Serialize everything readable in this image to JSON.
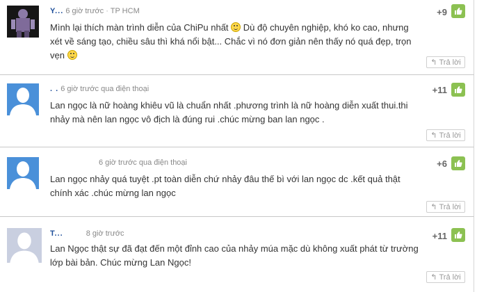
{
  "comments": [
    {
      "name": "Y...",
      "time": "6 giờ trước",
      "location": "TP HCM",
      "text_part1": "Mình lại thích màn trình diễn của ChiPu nhất",
      "text_part2": "Dù độ chuyên nghiệp, khó ko cao, nhưng xét về sáng tạo, chiều sâu thì khá nổi bật... Chắc vì nó đơn giản nên thấy nó quá đẹp, trọn vẹn",
      "score": "+9",
      "reply": "Trả lời"
    },
    {
      "name": ". .",
      "time": "6 giờ trước",
      "location": "qua điện thoại",
      "text": "Lan ngọc là nữ hoàng khiêu vũ là chuẩn nhất .phương trình là nữ hoàng diễn xuất thui.thi nhảy mà nên lan ngọc vô địch là đúng rui .chúc mừng ban lan ngọc .",
      "score": "+11",
      "reply": "Trả lời"
    },
    {
      "name": "",
      "time": "6 giờ trước",
      "location": "qua điện thoại",
      "text": "Lan ngọc nhảy quá tuyệt .pt toàn diễn chứ nhảy đâu thế bì với lan ngọc dc .kết quả thật chính xác .chúc mừng lan ngọc",
      "score": "+6",
      "reply": "Trả lời"
    },
    {
      "name": "T...",
      "time": "8 giờ trước",
      "location": "",
      "text": "Lan Ngọc thật sự đã đạt đến một đỉnh cao của nhảy múa mặc dù không xuất phát từ trường lớp bài bản. Chúc mừng Lan Ngọc!",
      "score": "+11",
      "reply": "Trả lời"
    }
  ],
  "colors": {
    "like": "#8cc152",
    "name": "#1f4f9a",
    "avatar_bg": "#4a90d9",
    "avatar_bg_light": "#c9cfe0"
  },
  "icons": {
    "like": "thumbs-up-icon",
    "reply": "reply-arrow-icon",
    "emoji": "smiley-icon"
  }
}
